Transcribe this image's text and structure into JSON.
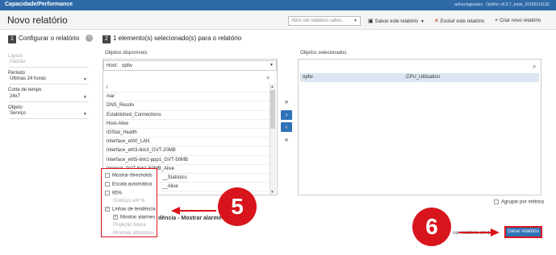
{
  "topbar": {
    "app_title": "Capacidade/Performance",
    "user_info": "arthur.fagundes · OpMon v6.5.7_trunk_2018011013Z"
  },
  "header": {
    "page_title": "Novo relatório",
    "open_report_placeholder": "Abrir um relatório salvo...",
    "save_label": "Salvar este relatório",
    "delete_label": "Excluir este relatório",
    "new_label": "Criar novo relatório"
  },
  "left": {
    "step": "1",
    "title": "Configurar o relatório",
    "layout_label": "Layout",
    "layout_value": "Padrão",
    "period_label": "Período",
    "period_value": "Últimas 24 horas",
    "timecut_label": "Corte de tempo",
    "timecut_value": "24x7",
    "object_label": "Objeto",
    "object_value": "Serviço"
  },
  "middle": {
    "step": "2",
    "title": "1 elemento(s) selecionado(s) para o relatório",
    "available_label": "Objetos disponíveis",
    "host_label": "Host:",
    "host_value": "opfw",
    "items": [
      "/",
      "/var",
      "DNS_Resolv",
      "Established_Connections",
      "Host-Alive",
      "IOStat_Health",
      "Interface_eth0_LAN",
      "Interface_eth3-link3_GVT-20MB",
      "Interface_eth5-link1-ppp1_GVT-50MB",
      "Internet_GVT-link1-50MB_Alive",
      "__Statistics",
      "__Alive"
    ]
  },
  "selected": {
    "label": "Objetos selecionados",
    "host": "opfw",
    "service": "CPU_Utilization",
    "group_by_metric": "Agrupar por métrica"
  },
  "movers": {
    "add_all": "»",
    "add": "›",
    "remove": "‹",
    "remove_all": "«"
  },
  "options": {
    "show_thresholds": "Mostrar thresholds",
    "auto_scale": "Escala automática",
    "p95": "95%",
    "percent_charts": "Gráficos em %",
    "trend_lines": "Linhas de tendência",
    "show_alarms": "Mostrar alarmes",
    "future_projection": "Projeção futura",
    "absolute_minimums": "Mínimas absolutos"
  },
  "under": {
    "trend_text": "dência - Mostrar alarme",
    "save_report_text": "var relatório em b"
  },
  "footer": {
    "generate": "Gerar relatório"
  },
  "callouts": {
    "step5": "5",
    "step6": "6"
  },
  "colors": {
    "brand": "#2f6aa8",
    "accent_button": "#2f73b8",
    "callout": "#d8141c"
  }
}
